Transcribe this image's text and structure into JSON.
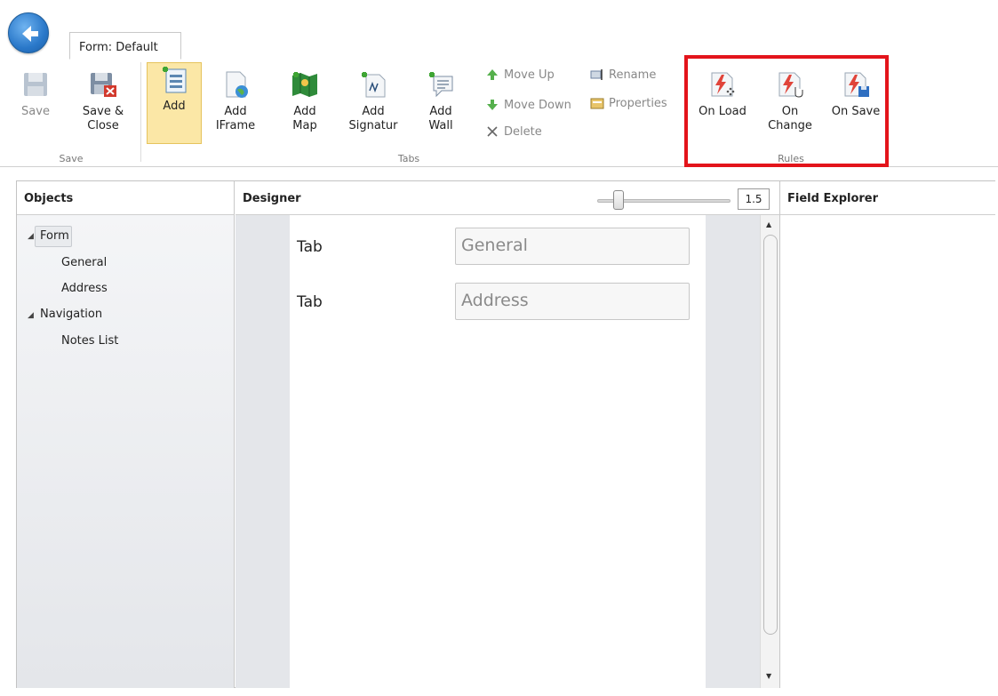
{
  "form_tab": {
    "label": "Form: Default"
  },
  "ribbon": {
    "save": {
      "label": "Save"
    },
    "save_close": {
      "line1": "Save &",
      "line2": "Close"
    },
    "add": {
      "label": "Add"
    },
    "add_iframe": {
      "line1": "Add",
      "line2": "IFrame"
    },
    "add_map": {
      "line1": "Add",
      "line2": "Map"
    },
    "add_signature": {
      "line1": "Add",
      "line2": "Signatur"
    },
    "add_wall": {
      "line1": "Add",
      "line2": "Wall"
    },
    "move_up": {
      "label": "Move Up"
    },
    "move_down": {
      "label": "Move Down"
    },
    "delete": {
      "label": "Delete"
    },
    "rename": {
      "label": "Rename"
    },
    "properties": {
      "label": "Properties"
    },
    "on_load": {
      "label": "On Load"
    },
    "on_change": {
      "line1": "On",
      "line2": "Change"
    },
    "on_save": {
      "label": "On Save"
    },
    "groups": {
      "save": "Save",
      "tabs": "Tabs",
      "rules": "Rules"
    }
  },
  "panels": {
    "objects": {
      "title": "Objects",
      "tree": [
        {
          "label": "Form"
        },
        {
          "label": "General"
        },
        {
          "label": "Address"
        },
        {
          "label": "Navigation"
        },
        {
          "label": "Notes List"
        }
      ]
    },
    "designer": {
      "title": "Designer",
      "zoom": "1.5",
      "rows": [
        {
          "label": "Tab",
          "value": "General"
        },
        {
          "label": "Tab",
          "value": "Address"
        }
      ]
    },
    "explorer": {
      "title": "Field Explorer"
    }
  },
  "colors": {
    "highlight": "#e3141b",
    "active_button": "#fbe7a6",
    "accent": "#2a78c9"
  }
}
